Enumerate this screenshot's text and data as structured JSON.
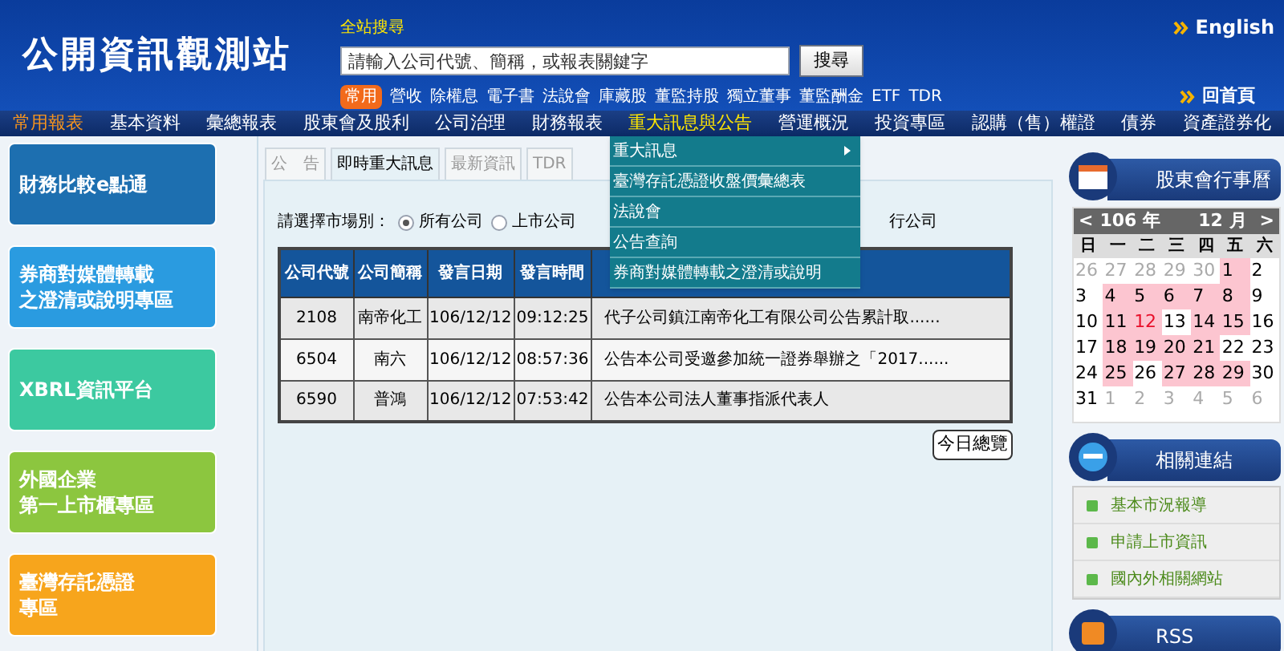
{
  "header": {
    "site_title": "公開資訊觀測站",
    "search_label": "全站搜尋",
    "search": {
      "placeholder": "請輸入公司代號、簡稱，或報表關鍵字"
    },
    "search_button": "搜尋",
    "english": "English",
    "home": "回首頁",
    "quick_badge": "常用",
    "quick_links": [
      "營收",
      "除權息",
      "電子書",
      "法說會",
      "庫藏股",
      "董監持股",
      "獨立董事",
      "董監酬金",
      "ETF",
      "TDR"
    ]
  },
  "nav": [
    {
      "label": "常用報表",
      "kind": "favorite",
      "expanded": false
    },
    {
      "label": "基本資料",
      "kind": "normal",
      "expanded": false
    },
    {
      "label": "彙總報表",
      "kind": "normal",
      "expanded": false
    },
    {
      "label": "股東會及股利",
      "kind": "normal",
      "expanded": false
    },
    {
      "label": "公司治理",
      "kind": "normal",
      "expanded": false
    },
    {
      "label": "財務報表",
      "kind": "normal",
      "expanded": false
    },
    {
      "label": "重大訊息與公告",
      "kind": "normal",
      "expanded": true
    },
    {
      "label": "營運概況",
      "kind": "normal",
      "expanded": false
    },
    {
      "label": "投資專區",
      "kind": "normal",
      "expanded": false
    },
    {
      "label": "認購（售）權證",
      "kind": "normal",
      "expanded": false
    },
    {
      "label": "債券",
      "kind": "normal",
      "expanded": false
    },
    {
      "label": "資產證券化",
      "kind": "normal",
      "expanded": false
    }
  ],
  "dropdown": [
    {
      "label": "重大訊息",
      "submenu": true
    },
    {
      "label": "臺灣存託憑證收盤價彙總表",
      "submenu": false
    },
    {
      "label": "法說會",
      "submenu": false
    },
    {
      "label": "公告查詢",
      "submenu": false
    },
    {
      "label": "券商對媒體轉載之澄清或說明",
      "submenu": false
    }
  ],
  "banners": [
    {
      "lines": [
        "財務比較e點通"
      ],
      "color": "#1d6fb0"
    },
    {
      "lines": [
        "券商對媒體轉載",
        "之澄清或說明專區"
      ],
      "color": "#2a9be0"
    },
    {
      "lines": [
        "XBRL資訊平台"
      ],
      "color": "#3cc9a0"
    },
    {
      "lines": [
        "外國企業",
        "第一上市櫃專區"
      ],
      "color": "#8cc63f"
    },
    {
      "lines": [
        "臺灣存託憑證",
        "專區"
      ],
      "color": "#f7a51c"
    }
  ],
  "tabs": [
    {
      "label": "公　告",
      "selected": false
    },
    {
      "label": "即時重大訊息",
      "selected": true
    },
    {
      "label": "最新資訊",
      "selected": false
    },
    {
      "label": "TDR",
      "selected": false
    }
  ],
  "market_label": "請選擇市場別：",
  "markets": [
    {
      "label": "所有公司",
      "selected": true
    },
    {
      "label": "上市公司",
      "selected": false
    }
  ],
  "market_tail": "行公司",
  "table": {
    "columns": [
      "公司代號",
      "公司簡稱",
      "發言日期",
      "發言時間"
    ],
    "rows": [
      [
        "2108",
        "南帝化工",
        "106/12/12",
        "09:12:25",
        "代子公司鎮江南帝化工有限公司公告累計取......"
      ],
      [
        "6504",
        "南六",
        "106/12/12",
        "08:57:36",
        "公告本公司受邀參加統一證券舉辦之「2017......"
      ],
      [
        "6590",
        "普鴻",
        "106/12/12",
        "07:53:42",
        "公告本公司法人董事指派代表人"
      ]
    ]
  },
  "today_button": "今日總覽",
  "calendar": {
    "title": "股東會行事曆",
    "prev": "<",
    "year": "106 年",
    "month": "12 月",
    "next": ">",
    "weekdays": [
      "日",
      "一",
      "二",
      "三",
      "四",
      "五",
      "六"
    ],
    "days": [
      {
        "d": "26",
        "kind": "other",
        "marked": false,
        "today": false
      },
      {
        "d": "27",
        "kind": "other",
        "marked": false,
        "today": false
      },
      {
        "d": "28",
        "kind": "other",
        "marked": false,
        "today": false
      },
      {
        "d": "29",
        "kind": "other",
        "marked": false,
        "today": false
      },
      {
        "d": "30",
        "kind": "other",
        "marked": false,
        "today": false
      },
      {
        "d": "1",
        "kind": "current",
        "marked": true,
        "today": false
      },
      {
        "d": "2",
        "kind": "current",
        "marked": false,
        "today": false
      },
      {
        "d": "3",
        "kind": "current",
        "marked": false,
        "today": false
      },
      {
        "d": "4",
        "kind": "current",
        "marked": true,
        "today": false
      },
      {
        "d": "5",
        "kind": "current",
        "marked": true,
        "today": false
      },
      {
        "d": "6",
        "kind": "current",
        "marked": true,
        "today": false
      },
      {
        "d": "7",
        "kind": "current",
        "marked": true,
        "today": false
      },
      {
        "d": "8",
        "kind": "current",
        "marked": true,
        "today": false
      },
      {
        "d": "9",
        "kind": "current",
        "marked": false,
        "today": false
      },
      {
        "d": "10",
        "kind": "current",
        "marked": false,
        "today": false
      },
      {
        "d": "11",
        "kind": "current",
        "marked": true,
        "today": false
      },
      {
        "d": "12",
        "kind": "current",
        "marked": true,
        "today": true
      },
      {
        "d": "13",
        "kind": "current",
        "marked": false,
        "today": false
      },
      {
        "d": "14",
        "kind": "current",
        "marked": true,
        "today": false
      },
      {
        "d": "15",
        "kind": "current",
        "marked": true,
        "today": false
      },
      {
        "d": "16",
        "kind": "current",
        "marked": false,
        "today": false
      },
      {
        "d": "17",
        "kind": "current",
        "marked": false,
        "today": false
      },
      {
        "d": "18",
        "kind": "current",
        "marked": true,
        "today": false
      },
      {
        "d": "19",
        "kind": "current",
        "marked": true,
        "today": false
      },
      {
        "d": "20",
        "kind": "current",
        "marked": true,
        "today": false
      },
      {
        "d": "21",
        "kind": "current",
        "marked": true,
        "today": false
      },
      {
        "d": "22",
        "kind": "current",
        "marked": false,
        "today": false
      },
      {
        "d": "23",
        "kind": "current",
        "marked": false,
        "today": false
      },
      {
        "d": "24",
        "kind": "current",
        "marked": false,
        "today": false
      },
      {
        "d": "25",
        "kind": "current",
        "marked": true,
        "today": false
      },
      {
        "d": "26",
        "kind": "current",
        "marked": false,
        "today": false
      },
      {
        "d": "27",
        "kind": "current",
        "marked": true,
        "today": false
      },
      {
        "d": "28",
        "kind": "current",
        "marked": true,
        "today": false
      },
      {
        "d": "29",
        "kind": "current",
        "marked": true,
        "today": false
      },
      {
        "d": "30",
        "kind": "current",
        "marked": false,
        "today": false
      },
      {
        "d": "31",
        "kind": "current",
        "marked": false,
        "today": false
      },
      {
        "d": "1",
        "kind": "other",
        "marked": false,
        "today": false
      },
      {
        "d": "2",
        "kind": "other",
        "marked": false,
        "today": false
      },
      {
        "d": "3",
        "kind": "other",
        "marked": false,
        "today": false
      },
      {
        "d": "4",
        "kind": "other",
        "marked": false,
        "today": false
      },
      {
        "d": "5",
        "kind": "other",
        "marked": false,
        "today": false
      },
      {
        "d": "6",
        "kind": "other",
        "marked": false,
        "today": false
      }
    ]
  },
  "related": {
    "title": "相關連結",
    "links": [
      "基本市況報導",
      "申請上市資訊",
      "國內外相關網站"
    ]
  },
  "rss": {
    "title": "RSS"
  }
}
